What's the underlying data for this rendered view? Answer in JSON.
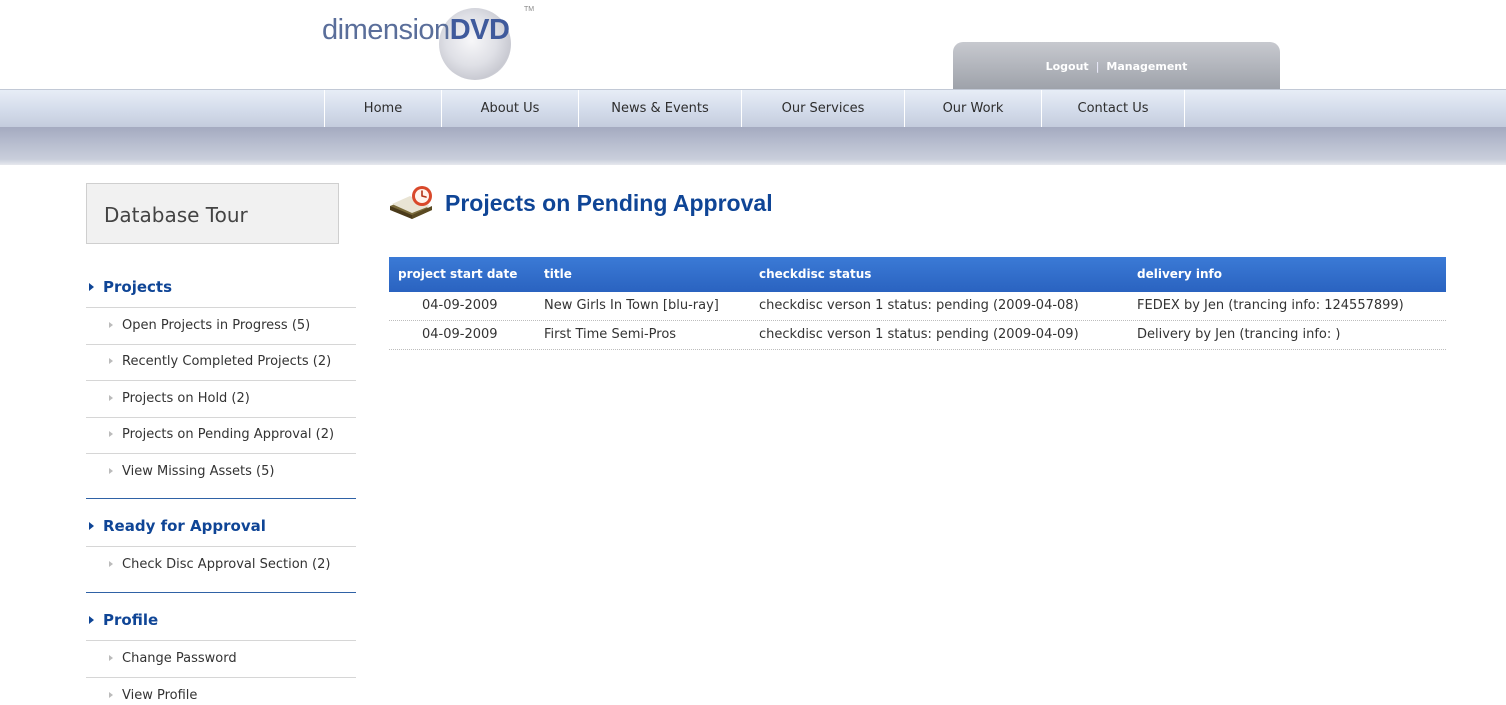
{
  "logo": {
    "word": "dimension",
    "brand": "DVD",
    "tm": "TM"
  },
  "account": {
    "logout": "Logout",
    "separator": "|",
    "management": "Management"
  },
  "nav": [
    {
      "label": "Home"
    },
    {
      "label": "About Us"
    },
    {
      "label": "News & Events"
    },
    {
      "label": "Our Services"
    },
    {
      "label": "Our Work"
    },
    {
      "label": "Contact Us"
    },
    {
      "label": ""
    }
  ],
  "sidebar": {
    "box_title": "Database Tour",
    "sections": [
      {
        "title": "Projects",
        "items": [
          "Open Projects in Progress (5)",
          "Recently Completed Projects (2)",
          "Projects on Hold (2)",
          "Projects on Pending Approval (2)",
          "View Missing Assets (5)"
        ]
      },
      {
        "title": "Ready for Approval",
        "items": [
          "Check Disc Approval Section (2)"
        ]
      },
      {
        "title": "Profile",
        "items": [
          "Change Password",
          "View Profile"
        ]
      }
    ]
  },
  "main": {
    "title": "Projects on Pending Approval",
    "table": {
      "headers": [
        "project start date",
        "title",
        "checkdisc status",
        "delivery info"
      ],
      "rows": [
        [
          "04-09-2009",
          "New Girls In Town [blu-ray]",
          "checkdisc verson 1 status: pending (2009-04-08)",
          "FEDEX by Jen (trancing info: 124557899)"
        ],
        [
          "04-09-2009",
          "First Time Semi-Pros",
          "checkdisc verson 1 status: pending (2009-04-09)",
          "Delivery by Jen (trancing info: )"
        ]
      ]
    }
  },
  "colors": {
    "accent": "#0f4596",
    "table_header": "#2f6bc9",
    "nav_band": "#b6bcce"
  }
}
